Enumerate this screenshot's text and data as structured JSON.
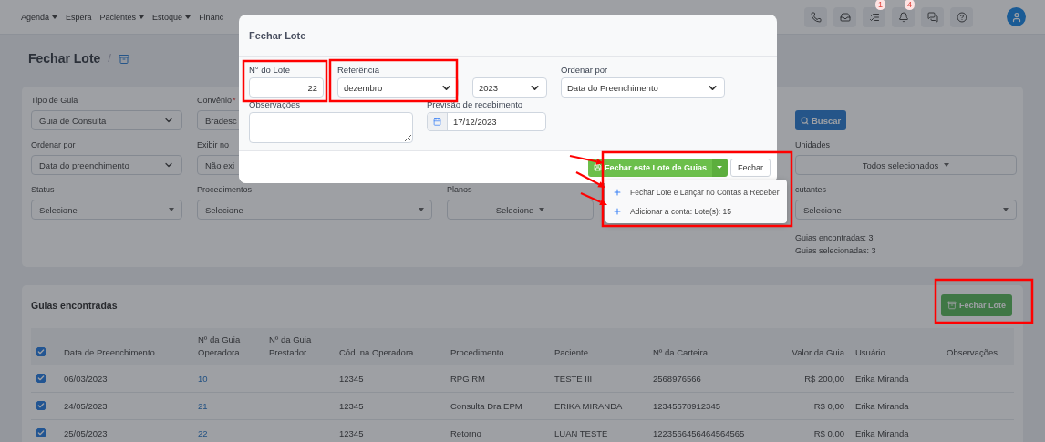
{
  "nav": {
    "items": [
      {
        "label": "Agenda",
        "caret": true
      },
      {
        "label": "Espera",
        "caret": false
      },
      {
        "label": "Pacientes",
        "caret": true
      },
      {
        "label": "Estoque",
        "caret": true
      },
      {
        "label": "Financ",
        "caret": false
      }
    ],
    "icons": [
      {
        "kind": "phone"
      },
      {
        "kind": "inbox"
      },
      {
        "kind": "list",
        "badge": "1"
      },
      {
        "kind": "bell",
        "badge": "4"
      },
      {
        "kind": "chat"
      },
      {
        "kind": "help"
      }
    ]
  },
  "page": {
    "title": "Fechar Lote",
    "separator": "/"
  },
  "filters": {
    "rows": [
      {
        "fields": [
          {
            "label": "Tipo de Guia",
            "value": "Guia de Consulta",
            "kind": "select"
          },
          {
            "label": "Convênio",
            "required_mark": "*",
            "value": "Bradesc",
            "kind": "covered"
          }
        ],
        "right": {
          "kind": "button",
          "value": "Buscar"
        }
      },
      {
        "fields": [
          {
            "label": "Ordenar por",
            "value": "Data do preenchimento",
            "kind": "select"
          },
          {
            "label": "Exibir no",
            "value": "Não exi",
            "kind": "covered"
          }
        ],
        "right": {
          "kind": "multiselect",
          "label": "Unidades",
          "value": "Todos selecionados"
        }
      },
      {
        "fields": [
          {
            "label": "Status",
            "value": "Selecione",
            "kind": "dropdown"
          },
          {
            "label": "Procedimentos",
            "value": "Selecione",
            "kind": "dropdown"
          },
          {
            "label": "Planos",
            "value": "Selecione",
            "kind": "multiselect"
          }
        ],
        "right": {
          "kind": "dropdown",
          "label": "cutantes",
          "value": "Selecione"
        }
      }
    ],
    "summary": [
      "Guias encontradas: 3",
      "Guias selecionadas: 3"
    ]
  },
  "results": {
    "title": "Guias encontradas",
    "button": "Fechar Lote",
    "all_selected": true,
    "columns": [
      "Data de Preenchimento",
      "Nº da Guia Operadora",
      "Nº da Guia Prestador",
      "Cód. na Operadora",
      "Procedimento",
      "Paciente",
      "Nº da Carteira",
      "Valor da Guia",
      "Usuário",
      "Observações"
    ],
    "rows": [
      {
        "selected": true,
        "cells": [
          "06/03/2023",
          "10",
          "",
          "12345",
          "RPG RM",
          "TESTE III",
          "2568976566",
          "R$ 200,00",
          "Erika Miranda",
          ""
        ]
      },
      {
        "selected": true,
        "cells": [
          "24/05/2023",
          "21",
          "",
          "12345",
          "Consulta Dra EPM",
          "ERIKA MIRANDA",
          "12345678912345",
          "R$ 0,00",
          "Erika Miranda",
          ""
        ]
      },
      {
        "selected": true,
        "cells": [
          "25/05/2023",
          "22",
          "",
          "12345",
          "Retorno",
          "LUAN TESTE",
          "1223566456464564565",
          "R$ 0,00",
          "Erika Miranda",
          ""
        ]
      }
    ]
  },
  "modal": {
    "title": "Fechar Lote",
    "fields": [
      {
        "label": "N° do Lote",
        "value": "22",
        "kind": "number"
      },
      {
        "label": "Referência",
        "value": "dezembro",
        "kind": "select"
      },
      {
        "value": "2023",
        "kind": "select"
      },
      {
        "label": "Ordenar por",
        "value": "Data do Preenchimento",
        "kind": "select"
      }
    ],
    "notes": {
      "label": "Observações"
    },
    "due": {
      "label": "Previsão de recebimento",
      "value": "17/12/2023"
    },
    "primary_button": "Fechar este Lote de Guias",
    "close_button": "Fechar",
    "menu": [
      "Fechar Lote e Lançar no Contas a Receber",
      "Adicionar a conta: Lote(s): 15"
    ]
  }
}
